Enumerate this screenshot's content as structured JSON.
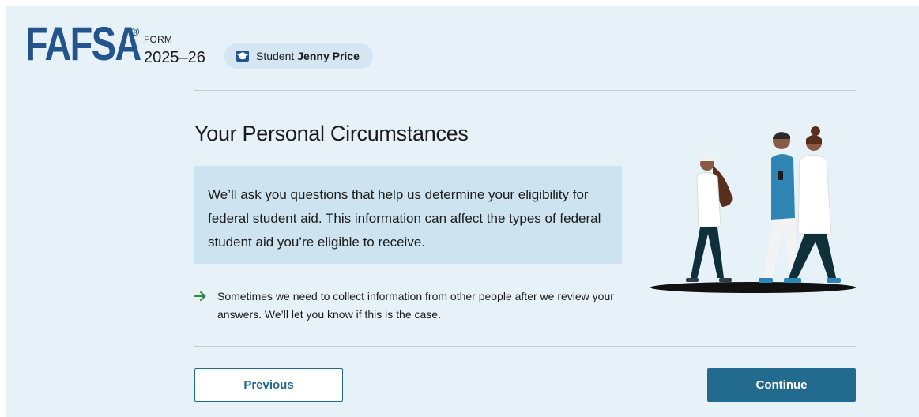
{
  "header": {
    "logo_text": "FAFSA",
    "logo_reg": "®",
    "form_label": "FORM",
    "form_year": "2025–26",
    "student_role": "Student",
    "student_name": "Jenny Price"
  },
  "main": {
    "title": "Your Personal Circumstances",
    "info_text": "We’ll ask you questions that help us determine your eligibility for federal student aid. This information can affect the types of federal student aid you’re eligible to receive.",
    "note_text": "Sometimes we need to collect information from other people after we review your answers. We’ll let you know if this is the case."
  },
  "buttons": {
    "previous": "Previous",
    "continue": "Continue"
  },
  "icons": {
    "student": "graduation-cap-icon",
    "note": "arrow-right-icon"
  },
  "colors": {
    "background": "#e7f2f8",
    "brand": "#23548c",
    "primary_button": "#236a8f",
    "info_box": "#cde4f0",
    "arrow": "#2e8540"
  }
}
